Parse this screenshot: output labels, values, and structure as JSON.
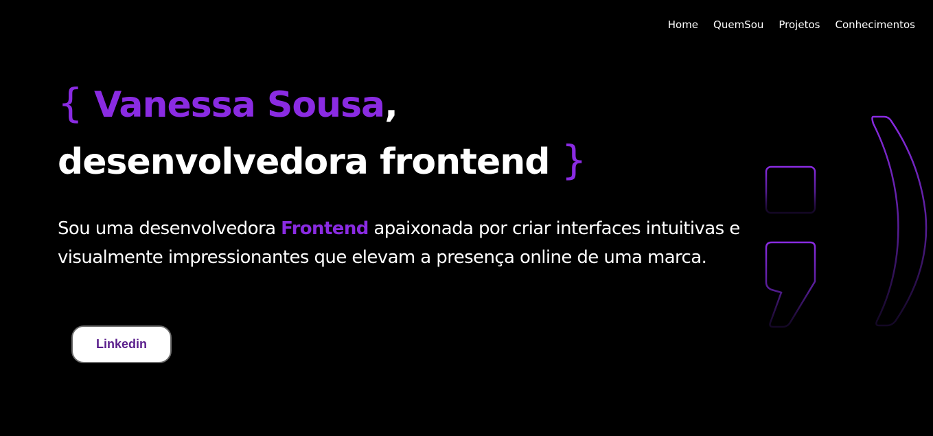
{
  "nav": {
    "items": [
      "Home",
      "QuemSou",
      "Projetos",
      "Conhecimentos"
    ]
  },
  "hero": {
    "brace_open": "{",
    "name": "Vanessa Sousa",
    "comma": ",",
    "role": "desenvolvedora frontend",
    "brace_close": "}"
  },
  "intro": {
    "part1": "Sou uma desenvolvedora ",
    "highlight": "Frontend",
    "part2": " apaixonada por criar interfaces intuitivas e visualmente impressionantes que elevam a presença online de uma marca."
  },
  "cta": {
    "label": "Linkedin"
  },
  "colors": {
    "background": "#000000",
    "accent": "#8a2be2",
    "text": "#ffffff",
    "button_text": "#5a1e8c"
  },
  "icons": {
    "decoration": "semicolon-parenthesis-icon"
  }
}
